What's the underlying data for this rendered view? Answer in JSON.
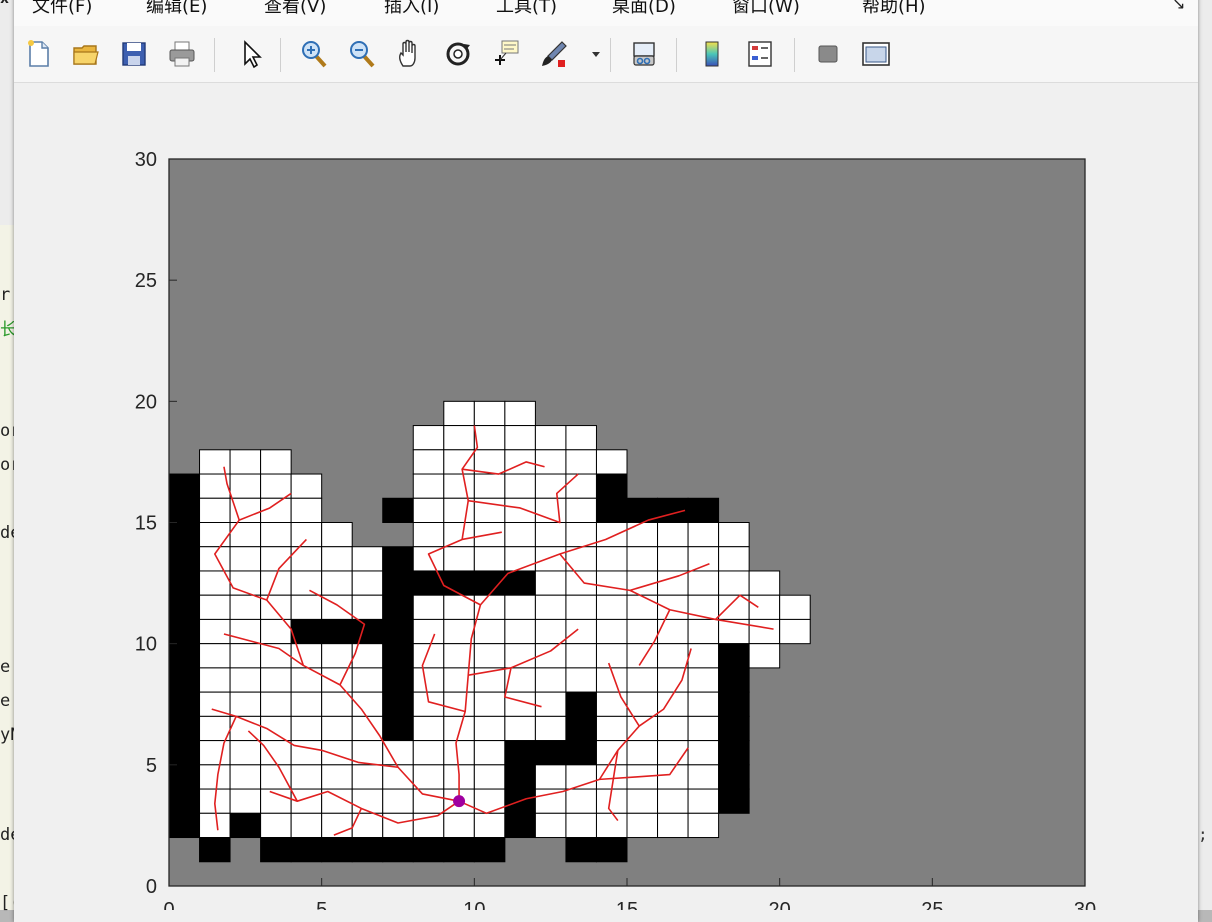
{
  "menu": {
    "items": [
      "文件(F)",
      "编辑(E)",
      "查看(V)",
      "插入(I)",
      "工具(T)",
      "桌面(D)",
      "窗口(W)",
      "帮助(H)"
    ]
  },
  "toolbar": {
    "buttons": [
      "new-file-icon",
      "open-folder-icon",
      "save-icon",
      "print-icon",
      "select-arrow-icon",
      "zoom-in-icon",
      "zoom-out-icon",
      "pan-hand-icon",
      "rotate-3d-icon",
      "data-cursor-icon",
      "brush-icon",
      "link-plot-icon",
      "colorbar-icon",
      "legend-icon",
      "hide-plot-tools-icon",
      "show-plot-tools-icon"
    ]
  },
  "background": {
    "left_fragments": [
      "x",
      "r",
      "长",
      "or",
      "or",
      "de",
      "e.",
      "e.",
      "yN",
      "de",
      "[("
    ],
    "right_fragment": ";"
  },
  "chart_data": {
    "type": "heatmap",
    "title": "",
    "xlabel": "",
    "ylabel": "",
    "xlim": [
      0,
      30
    ],
    "ylim": [
      0,
      30
    ],
    "xticks": [
      0,
      5,
      10,
      15,
      20,
      25,
      30
    ],
    "yticks": [
      0,
      5,
      10,
      15,
      20,
      25,
      30
    ],
    "tick_labels_x": [
      "0",
      "5",
      "10",
      "15",
      "20",
      "25",
      "30"
    ],
    "tick_labels_y": [
      "0",
      "5",
      "10",
      "15",
      "20",
      "25",
      "30"
    ],
    "legend": [
      {
        "value": 0,
        "meaning": "unexplored",
        "color": "#808080"
      },
      {
        "value": 1,
        "meaning": "free",
        "color": "#ffffff"
      },
      {
        "value": 2,
        "meaning": "obstacle",
        "color": "#000000"
      }
    ],
    "grid_rows_top_to_bottom": [
      {
        "y": 19,
        "cells": [
          [
            9,
            12,
            1
          ]
        ]
      },
      {
        "y": 18,
        "cells": [
          [
            8,
            14,
            1
          ]
        ]
      },
      {
        "y": 17,
        "cells": [
          [
            1,
            4,
            1
          ],
          [
            8,
            15,
            1
          ]
        ]
      },
      {
        "y": 16,
        "cells": [
          [
            0,
            1,
            2
          ],
          [
            1,
            5,
            1
          ],
          [
            8,
            14,
            1
          ],
          [
            14,
            15,
            2
          ]
        ]
      },
      {
        "y": 15,
        "cells": [
          [
            0,
            1,
            2
          ],
          [
            1,
            5,
            1
          ],
          [
            7,
            8,
            2
          ],
          [
            8,
            14,
            1
          ],
          [
            14,
            18,
            2
          ]
        ]
      },
      {
        "y": 14,
        "cells": [
          [
            0,
            1,
            2
          ],
          [
            1,
            6,
            1
          ],
          [
            8,
            19,
            1
          ]
        ]
      },
      {
        "y": 13,
        "cells": [
          [
            0,
            1,
            2
          ],
          [
            1,
            7,
            1
          ],
          [
            7,
            8,
            2
          ],
          [
            8,
            19,
            1
          ]
        ]
      },
      {
        "y": 12,
        "cells": [
          [
            0,
            1,
            2
          ],
          [
            1,
            7,
            1
          ],
          [
            7,
            8,
            2
          ],
          [
            8,
            12,
            2
          ],
          [
            12,
            20,
            1
          ]
        ]
      },
      {
        "y": 11,
        "cells": [
          [
            0,
            1,
            2
          ],
          [
            1,
            7,
            1
          ],
          [
            7,
            8,
            2
          ],
          [
            8,
            21,
            1
          ]
        ]
      },
      {
        "y": 10,
        "cells": [
          [
            0,
            1,
            2
          ],
          [
            1,
            4,
            1
          ],
          [
            4,
            8,
            2
          ],
          [
            8,
            21,
            1
          ]
        ]
      },
      {
        "y": 9,
        "cells": [
          [
            0,
            1,
            2
          ],
          [
            1,
            7,
            1
          ],
          [
            7,
            8,
            2
          ],
          [
            8,
            18,
            1
          ],
          [
            18,
            19,
            2
          ],
          [
            19,
            20,
            1
          ]
        ]
      },
      {
        "y": 8,
        "cells": [
          [
            0,
            1,
            2
          ],
          [
            1,
            7,
            1
          ],
          [
            7,
            8,
            2
          ],
          [
            8,
            18,
            1
          ],
          [
            18,
            19,
            2
          ]
        ]
      },
      {
        "y": 7,
        "cells": [
          [
            0,
            1,
            2
          ],
          [
            1,
            7,
            1
          ],
          [
            7,
            8,
            2
          ],
          [
            8,
            13,
            1
          ],
          [
            13,
            14,
            2
          ],
          [
            14,
            18,
            1
          ],
          [
            18,
            19,
            2
          ]
        ]
      },
      {
        "y": 6,
        "cells": [
          [
            0,
            1,
            2
          ],
          [
            1,
            7,
            1
          ],
          [
            7,
            8,
            2
          ],
          [
            8,
            13,
            1
          ],
          [
            13,
            14,
            2
          ],
          [
            14,
            18,
            1
          ],
          [
            18,
            19,
            2
          ]
        ]
      },
      {
        "y": 5,
        "cells": [
          [
            0,
            1,
            2
          ],
          [
            1,
            11,
            1
          ],
          [
            11,
            14,
            2
          ],
          [
            14,
            18,
            1
          ],
          [
            18,
            19,
            2
          ]
        ]
      },
      {
        "y": 4,
        "cells": [
          [
            0,
            1,
            2
          ],
          [
            1,
            11,
            1
          ],
          [
            11,
            12,
            2
          ],
          [
            12,
            18,
            1
          ],
          [
            18,
            19,
            2
          ]
        ]
      },
      {
        "y": 3,
        "cells": [
          [
            0,
            1,
            2
          ],
          [
            1,
            11,
            1
          ],
          [
            11,
            12,
            2
          ],
          [
            12,
            18,
            1
          ],
          [
            18,
            19,
            2
          ]
        ]
      },
      {
        "y": 2,
        "cells": [
          [
            0,
            1,
            2
          ],
          [
            1,
            2,
            1
          ],
          [
            2,
            3,
            2
          ],
          [
            3,
            11,
            1
          ],
          [
            11,
            12,
            2
          ],
          [
            12,
            18,
            1
          ]
        ]
      },
      {
        "y": 1,
        "cells": [
          [
            1,
            2,
            2
          ],
          [
            3,
            11,
            2
          ],
          [
            13,
            15,
            2
          ]
        ]
      }
    ],
    "robot": {
      "x": 9.5,
      "y": 3.5,
      "color": "#a000a0"
    },
    "tree_color": "#e02020",
    "tree_edges": [
      [
        [
          9.5,
          3.5
        ],
        [
          9.5,
          4.6
        ],
        [
          9.4,
          5.9
        ],
        [
          9.7,
          7.2
        ],
        [
          9.8,
          8.7
        ],
        [
          9.9,
          10.2
        ],
        [
          10.2,
          11.6
        ]
      ],
      [
        [
          10.2,
          11.6
        ],
        [
          11.1,
          12.9
        ],
        [
          12.8,
          13.7
        ],
        [
          14.3,
          14.3
        ],
        [
          15.7,
          15.1
        ],
        [
          16.9,
          15.5
        ]
      ],
      [
        [
          12.8,
          13.7
        ],
        [
          13.6,
          12.5
        ],
        [
          15.1,
          12.2
        ],
        [
          16.7,
          12.8
        ],
        [
          17.7,
          13.3
        ]
      ],
      [
        [
          15.1,
          12.2
        ],
        [
          16.4,
          11.4
        ],
        [
          17.9,
          11.0
        ],
        [
          19.8,
          10.6
        ]
      ],
      [
        [
          16.4,
          11.4
        ],
        [
          15.9,
          10.1
        ],
        [
          15.4,
          9.1
        ]
      ],
      [
        [
          17.9,
          11.0
        ],
        [
          18.7,
          12.0
        ],
        [
          19.3,
          11.5
        ]
      ],
      [
        [
          9.7,
          7.2
        ],
        [
          8.5,
          7.6
        ],
        [
          8.3,
          9.1
        ],
        [
          8.7,
          10.4
        ]
      ],
      [
        [
          9.8,
          8.7
        ],
        [
          11.2,
          9.0
        ],
        [
          12.5,
          9.7
        ],
        [
          13.4,
          10.6
        ]
      ],
      [
        [
          11.2,
          9.0
        ],
        [
          11.0,
          7.8
        ],
        [
          12.2,
          7.4
        ]
      ],
      [
        [
          10.2,
          11.6
        ],
        [
          9.0,
          12.4
        ],
        [
          8.5,
          13.7
        ],
        [
          9.6,
          14.3
        ],
        [
          10.9,
          14.6
        ]
      ],
      [
        [
          9.6,
          14.3
        ],
        [
          9.8,
          15.9
        ],
        [
          9.6,
          17.2
        ],
        [
          10.1,
          18.1
        ],
        [
          10.0,
          19.0
        ]
      ],
      [
        [
          9.8,
          15.9
        ],
        [
          11.5,
          15.6
        ],
        [
          12.8,
          15.0
        ],
        [
          12.7,
          16.2
        ],
        [
          13.4,
          17.0
        ]
      ],
      [
        [
          9.6,
          17.2
        ],
        [
          10.8,
          17.0
        ],
        [
          11.7,
          17.5
        ],
        [
          12.3,
          17.3
        ]
      ],
      [
        [
          9.5,
          3.5
        ],
        [
          8.3,
          3.8
        ],
        [
          7.5,
          4.9
        ],
        [
          6.2,
          5.1
        ],
        [
          5.0,
          5.6
        ],
        [
          4.1,
          5.8
        ],
        [
          3.2,
          6.5
        ],
        [
          2.2,
          7.0
        ],
        [
          1.4,
          7.3
        ]
      ],
      [
        [
          7.5,
          4.9
        ],
        [
          6.9,
          6.2
        ],
        [
          6.3,
          7.3
        ],
        [
          5.6,
          8.3
        ],
        [
          4.4,
          9.1
        ],
        [
          3.6,
          9.8
        ],
        [
          2.7,
          10.1
        ],
        [
          1.8,
          10.4
        ]
      ],
      [
        [
          5.6,
          8.3
        ],
        [
          6.1,
          9.6
        ],
        [
          6.4,
          10.8
        ],
        [
          5.5,
          11.6
        ],
        [
          4.6,
          12.2
        ]
      ],
      [
        [
          4.4,
          9.1
        ],
        [
          4.0,
          10.6
        ],
        [
          3.2,
          11.8
        ],
        [
          2.1,
          12.3
        ],
        [
          1.5,
          13.7
        ],
        [
          2.3,
          15.1
        ],
        [
          3.3,
          15.6
        ],
        [
          4.0,
          16.2
        ]
      ],
      [
        [
          2.3,
          15.1
        ],
        [
          1.9,
          16.6
        ],
        [
          1.8,
          17.3
        ]
      ],
      [
        [
          3.2,
          11.8
        ],
        [
          3.6,
          13.1
        ],
        [
          4.5,
          14.3
        ]
      ],
      [
        [
          9.5,
          3.5
        ],
        [
          10.4,
          3.0
        ],
        [
          11.7,
          3.6
        ],
        [
          12.9,
          3.9
        ],
        [
          14.1,
          4.4
        ],
        [
          15.3,
          4.5
        ],
        [
          16.4,
          4.6
        ],
        [
          17.0,
          5.7
        ]
      ],
      [
        [
          14.1,
          4.4
        ],
        [
          14.7,
          5.6
        ],
        [
          15.4,
          6.6
        ],
        [
          16.2,
          7.3
        ],
        [
          16.8,
          8.5
        ],
        [
          17.1,
          9.8
        ]
      ],
      [
        [
          15.4,
          6.6
        ],
        [
          14.8,
          7.8
        ],
        [
          14.4,
          9.2
        ]
      ],
      [
        [
          14.7,
          5.6
        ],
        [
          14.4,
          3.2
        ],
        [
          14.7,
          2.7
        ]
      ],
      [
        [
          9.5,
          3.5
        ],
        [
          8.8,
          2.9
        ],
        [
          7.5,
          2.6
        ],
        [
          6.3,
          3.2
        ],
        [
          5.2,
          3.9
        ],
        [
          4.2,
          3.5
        ],
        [
          3.3,
          3.9
        ]
      ],
      [
        [
          6.3,
          3.2
        ],
        [
          6.0,
          2.4
        ],
        [
          5.4,
          2.1
        ]
      ],
      [
        [
          4.2,
          3.5
        ],
        [
          3.6,
          4.9
        ],
        [
          3.1,
          5.8
        ],
        [
          2.6,
          6.4
        ]
      ],
      [
        [
          2.2,
          7.0
        ],
        [
          1.8,
          5.9
        ],
        [
          1.6,
          4.6
        ],
        [
          1.5,
          3.4
        ],
        [
          1.6,
          2.3
        ]
      ]
    ]
  }
}
